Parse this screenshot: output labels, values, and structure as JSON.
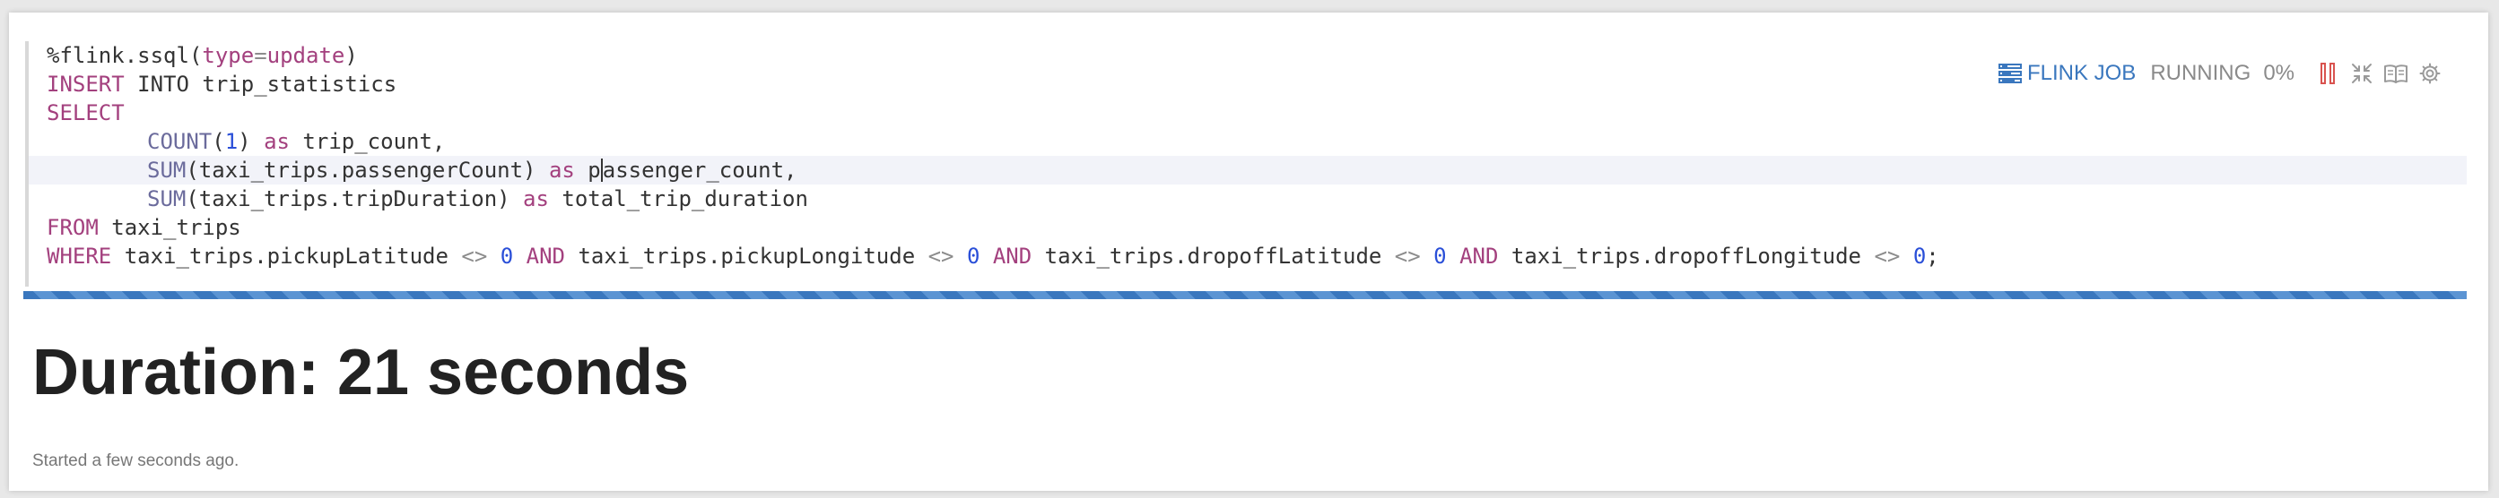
{
  "editor": {
    "lines": [
      [
        {
          "t": "%flink.ssql(",
          "c": "#333333"
        },
        {
          "t": "type",
          "c": "#a3407e"
        },
        {
          "t": "=",
          "c": "#8c8c8c"
        },
        {
          "t": "update",
          "c": "#a3407e"
        },
        {
          "t": ")",
          "c": "#333333"
        }
      ],
      [
        {
          "t": "INSERT",
          "c": "#a3407e"
        },
        {
          "t": " INTO trip_statistics",
          "c": "#333333"
        }
      ],
      [
        {
          "t": "SELECT",
          "c": "#a3407e"
        }
      ],
      [
        {
          "t": "COUNT",
          "c": "#6b6b9c"
        },
        {
          "t": "(",
          "c": "#333333"
        },
        {
          "t": "1",
          "c": "#2a4fd8"
        },
        {
          "t": ") ",
          "c": "#333333"
        },
        {
          "t": "as",
          "c": "#a3407e"
        },
        {
          "t": " trip_count,",
          "c": "#333333"
        }
      ],
      [
        {
          "t": "SUM",
          "c": "#6b6b9c"
        },
        {
          "t": "(taxi_trips.passengerCount) ",
          "c": "#333333"
        },
        {
          "t": "as",
          "c": "#a3407e"
        },
        {
          "t": " p",
          "c": "#333333"
        },
        {
          "cursor": true
        },
        {
          "t": "assenger_count,",
          "c": "#333333"
        }
      ],
      [
        {
          "t": "SUM",
          "c": "#6b6b9c"
        },
        {
          "t": "(taxi_trips.tripDuration) ",
          "c": "#333333"
        },
        {
          "t": "as",
          "c": "#a3407e"
        },
        {
          "t": " total_trip_duration",
          "c": "#333333"
        }
      ],
      [
        {
          "t": "FROM",
          "c": "#a3407e"
        },
        {
          "t": " taxi_trips",
          "c": "#333333"
        }
      ],
      [
        {
          "t": "WHERE",
          "c": "#a3407e"
        },
        {
          "t": " taxi_trips.pickupLatitude ",
          "c": "#333333"
        },
        {
          "t": "<>",
          "c": "#8c8c8c"
        },
        {
          "t": " ",
          "c": "#333333"
        },
        {
          "t": "0",
          "c": "#2a4fd8"
        },
        {
          "t": " ",
          "c": "#333333"
        },
        {
          "t": "AND",
          "c": "#a3407e"
        },
        {
          "t": " taxi_trips.pickupLongitude ",
          "c": "#333333"
        },
        {
          "t": "<>",
          "c": "#8c8c8c"
        },
        {
          "t": " ",
          "c": "#333333"
        },
        {
          "t": "0",
          "c": "#2a4fd8"
        },
        {
          "t": " ",
          "c": "#333333"
        },
        {
          "t": "AND",
          "c": "#a3407e"
        },
        {
          "t": " taxi_trips.dropoffLatitude ",
          "c": "#333333"
        },
        {
          "t": "<>",
          "c": "#8c8c8c"
        },
        {
          "t": " ",
          "c": "#333333"
        },
        {
          "t": "0",
          "c": "#2a4fd8"
        },
        {
          "t": " ",
          "c": "#333333"
        },
        {
          "t": "AND",
          "c": "#a3407e"
        },
        {
          "t": " taxi_trips.dropoffLongitude ",
          "c": "#333333"
        },
        {
          "t": "<>",
          "c": "#8c8c8c"
        },
        {
          "t": " ",
          "c": "#333333"
        },
        {
          "t": "0",
          "c": "#2a4fd8"
        },
        {
          "t": ";",
          "c": "#333333"
        }
      ]
    ],
    "indented_lines": [
      3,
      4,
      5
    ],
    "highlighted_line": 4
  },
  "toolbar": {
    "job_link_label": "FLINK JOB",
    "status_label": "RUNNING",
    "progress_label": "0%",
    "progress": 0,
    "link_color": "#3a77be",
    "status_color": "#8a8a8a",
    "cancel_color": "#d9534f",
    "icon_color": "#9a9a9a",
    "icons": [
      "job-list-icon",
      "cancel-icon",
      "collapse-icon",
      "book-icon",
      "gear-icon"
    ]
  },
  "result": {
    "duration_text": "Duration: 21 seconds",
    "started_text": "Started a few seconds ago.",
    "duration_color": "#222222",
    "started_color": "#777777"
  },
  "progress_bar_colors": [
    "#3a77be",
    "#5b94d3"
  ]
}
